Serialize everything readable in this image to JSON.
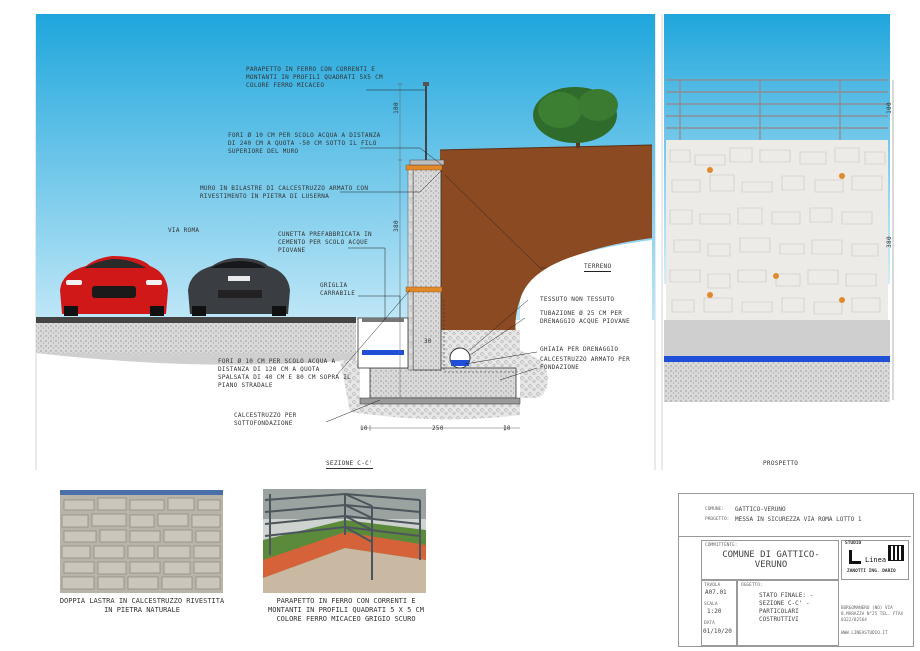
{
  "section": {
    "caption": "SEZIONE C-C'",
    "street_label": "VIA ROMA",
    "soil_label": "TERRENO",
    "dimensions": {
      "top_post": "100",
      "wall_height": "380",
      "footing_left": "10",
      "footing_width": "250",
      "footing_right": "10",
      "gutter": "30"
    },
    "annotations": {
      "railing": "PARAPETTO IN FERRO CON CORRENTI E MONTANTI IN PROFILI QUADRATI 5X5 CM COLORE FERRO MICACEO",
      "holes_upper": "FORI Ø 10 CM PER SCOLO ACQUA A DISTANZA DI 240 CM A QUOTA -50 CM SOTTO IL FILO SUPERIORE DEL MURO",
      "wall": "MURO IN BILASTRE DI CALCESTRUZZO ARMATO CON RIVESTIMENTO IN PIETRA DI LUSERNA",
      "gutter": "CUNETTA PREFABBRICATA IN CEMENTO PER SCOLO ACQUE PIOVANE",
      "grate": "GRIGLIA CARRABILE",
      "fabric": "TESSUTO NON TESSUTO",
      "drain_pipe": "TUBAZIONE Ø 25 CM PER DRENAGGIO ACQUE PIOVANE",
      "gravel": "GHIAIA PER DRENAGGIO",
      "footing": "CALCESTRUZZO ARMATO PER FONDAZIONE",
      "holes_lower": "FORI Ø 10 CM PER SCOLO ACQUA A DISTANZA DI 120 CM A QUOTA SPALSATA DI 40 CM E 80 CM SOPRA IL PIANO STRADALE",
      "subfoundation": "CALCESTRUZZO PER SOTTOFONDAZIONE"
    }
  },
  "elevation": {
    "caption": "PROSPETTO",
    "dim_height": "380",
    "dim_top": "100"
  },
  "photos": [
    {
      "caption": "DOPPIA LASTRA IN CALCESTRUZZO RIVESTITA IN PIETRA NATURALE"
    },
    {
      "caption": "PARAPETTO IN FERRO CON CORRENTI E MONTANTI IN PROFILI QUADRATI 5 X 5 CM COLORE FERRO MICACEO GRIGIO SCURO"
    }
  ],
  "title_block": {
    "comune_key": "COMUNE:",
    "comune": "GATTICO-VERUNO",
    "progetto_key": "PROGETTO:",
    "progetto": "MESSA IN SICUREZZA VIA ROMA LOTTO 1",
    "committente_key": "COMMITTENTE:",
    "committente": "COMUNE DI GATTICO-VERUNO",
    "studio_key": "STUDIO",
    "studio_logo": "Linea",
    "studio_name": "ZANOTTI ING. DARIO",
    "tavola_key": "TAVOLA",
    "tavola": "A07.01",
    "scala_key": "SCALA",
    "scala": "1:20",
    "data_key": "DATA",
    "data": "01/10/20",
    "oggetto_key": "OGGETTO:",
    "oggetto": "STATO FINALE: - SEZIONE C-C' - PARTICOLARI COSTRUTTIVI",
    "address": "BORGOMANERO (NO) VIA B.MARAZZA N°25 TEL. FTAX 0322/82564",
    "email": "WWW.LINEASTUDIO.IT"
  }
}
